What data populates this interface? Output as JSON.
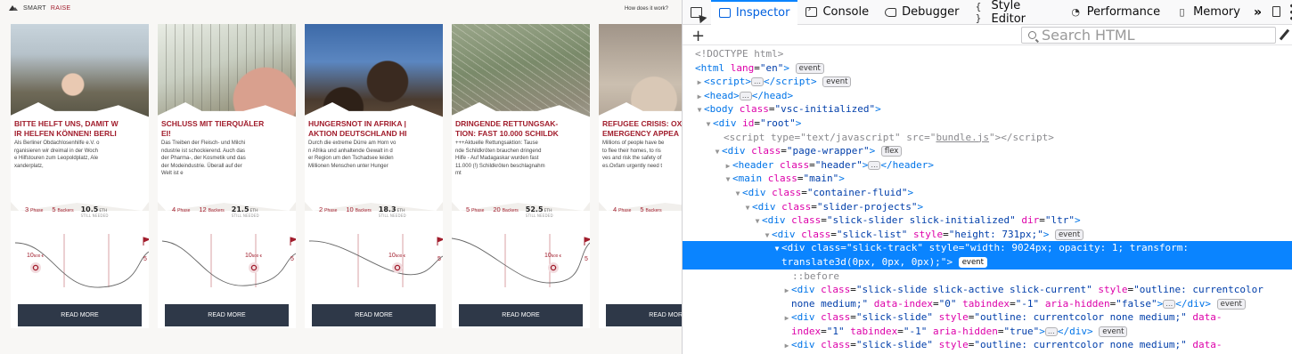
{
  "site": {
    "logo_smart": "SMART",
    "logo_raise": "RAISE",
    "how_link": "How does it work?",
    "read_more": "READ MORE",
    "cards": [
      {
        "title": [
          "BITTE HELFT UNS, DAMIT W",
          "IR HELFEN KÖNNEN! BERLI"
        ],
        "desc": [
          "Als Berliner Obdachlosenhilfe e.V. o",
          "rganisieren wir dreimal in der Woch",
          "e Hilfstouren zum Leopoldplatz, Ale",
          "xanderplatz,"
        ],
        "phase": "3",
        "backers": "5",
        "eth": "10.5",
        "graph_left": "10",
        "graph_right": "5"
      },
      {
        "title": [
          "SCHLUSS MIT TIERQUÄLER",
          "EI!"
        ],
        "desc": [
          "Das Treiben der Fleisch- und Milchi",
          "ndustrie ist schockierend. Auch das",
          "der Pharma-, der Kosmetik und das",
          "der Modeindustrie. Überall auf der",
          "Welt ist e"
        ],
        "phase": "4",
        "backers": "12",
        "eth": "21.5",
        "graph_left": "10",
        "graph_right": "5"
      },
      {
        "title": [
          "HUNGERSNOT IN AFRIKA |",
          "AKTION DEUTSCHLAND HI"
        ],
        "desc": [
          "Durch die extreme Dürre am Horn vo",
          "n Afrika und anhaltende Gewalt in d",
          "er Region um den Tschadsee leiden",
          "Millionen Menschen unter Hunger"
        ],
        "phase": "2",
        "backers": "10",
        "eth": "18.3",
        "graph_left": "10",
        "graph_right": "5"
      },
      {
        "title": [
          "DRINGENDE RETTUNGSAK-",
          "TION: FAST 10.000 SCHILDK"
        ],
        "desc": [
          "+++Aktuelle Rettungsaktion: Tause",
          "nde Schildkröten brauchen dringend",
          "Hilfe - Auf Madagaskar wurden fast",
          "11.000 (!) Schildkröten beschlagnahm",
          "mt"
        ],
        "phase": "5",
        "backers": "20",
        "eth": "52.5",
        "graph_left": "10",
        "graph_right": "5"
      },
      {
        "title": [
          "REFUGEE CRISIS: OX",
          "EMERGENCY APPEA"
        ],
        "desc": [
          "Millions of people have be",
          "to flee their homes, to ris",
          "ves and risk the safety of",
          "es.Oxfam urgently need t"
        ],
        "phase": "4",
        "backers": "5",
        "eth": "",
        "graph_left": "",
        "graph_right": ""
      }
    ],
    "labels": {
      "phase": "Phase",
      "backers": "Backers",
      "eth": "ETH",
      "eth_needed": "STILL NEEDED",
      "graph_unit": "500 €"
    },
    "colors": {
      "accent": "#a11d2c",
      "button": "#2e3848"
    }
  },
  "devtools": {
    "tabs": [
      {
        "label": "Inspector",
        "icon": "inspector-icon"
      },
      {
        "label": "Console",
        "icon": "console-icon"
      },
      {
        "label": "Debugger",
        "icon": "debugger-icon"
      },
      {
        "label": "Style Editor",
        "icon": "braces-icon"
      },
      {
        "label": "Performance",
        "icon": "performance-icon"
      },
      {
        "label": "Memory",
        "icon": "memory-icon"
      }
    ],
    "overflow": "»",
    "search_placeholder": "Search HTML",
    "badges": {
      "event": "event",
      "flex": "flex",
      "dots": "…"
    },
    "tree": {
      "doctype": "<!DOCTYPE html>",
      "html_tag": "html",
      "html_attr": "lang",
      "html_val": "\"en\"",
      "script_tag": "script",
      "head_tag": "head",
      "body_tag": "body",
      "body_attr": "class",
      "body_val": "\"vsc-initialized\"",
      "root_tag": "div",
      "root_attr": "id",
      "root_val": "\"root\"",
      "bundle_type": "\"text/javascript\"",
      "bundle_src": "bundle.js",
      "wrapper_val": "\"page-wrapper\"",
      "header_tag": "header",
      "header_val": "\"header\"",
      "main_tag": "main",
      "main_val": "\"main\"",
      "container_val": "\"container-fluid\"",
      "slider_projects_val": "\"slider-projects\"",
      "slick_slider_val": "\"slick-slider slick-initialized\"",
      "dir_val": "\"ltr\"",
      "slick_list_val": "\"slick-list\"",
      "slick_list_style": "\"height: 731px;\"",
      "track_val": "\"slick-track\"",
      "track_style_1": "\"width: 9024px; opacity: 1; transform:",
      "track_style_2": "translate3d(0px, 0px, 0px);\"",
      "before": "::before",
      "slide0_class": "\"slick-slide slick-active slick-current\"",
      "slide0_style_a": "\"outline: currentcolor",
      "slide0_style_b": "none medium;\"",
      "slide0_index": "\"0\"",
      "slide0_tab": "\"-1\"",
      "slide0_hidden": "\"false\"",
      "slide_class": "\"slick-slide\"",
      "slide_style": "\"outline: currentcolor none medium;\"",
      "slide1_index": "\"1\"",
      "slide1_tab": "\"-1\"",
      "slide1_hidden": "\"true\""
    }
  }
}
